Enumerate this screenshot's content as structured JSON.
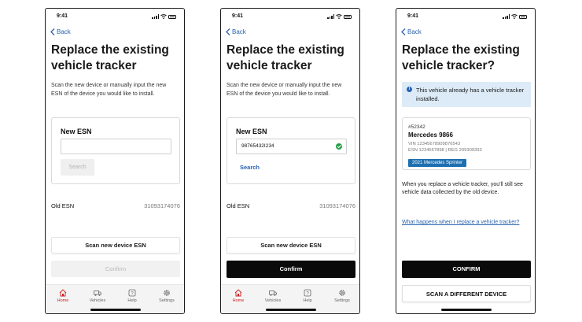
{
  "status_time": "9:41",
  "back_label": "Back",
  "screen1": {
    "title": "Replace the existing vehicle tracker",
    "description": "Scan the new device or manually input the new ESN of the device you would like to install.",
    "new_esn_label": "New ESN",
    "new_esn_value": "",
    "search_label": "Search",
    "old_esn_label": "Old ESN",
    "old_esn_value": "31093174076",
    "scan_button": "Scan new device ESN",
    "confirm_button": "Confirm"
  },
  "screen2": {
    "title": "Replace the existing vehicle tracker",
    "description": "Scan the new device or manually input the new ESN of the device you would like to install.",
    "new_esn_label": "New ESN",
    "new_esn_value": "98765432I234",
    "search_label": "Search",
    "old_esn_label": "Old ESN",
    "old_esn_value": "31093174076",
    "scan_button": "Scan new device ESN",
    "confirm_button": "Confirm"
  },
  "screen3": {
    "title": "Replace the existing vehicle tracker?",
    "info_text": "This vehicle already has a vehicle tracker installed.",
    "vehicle": {
      "number": "#52342",
      "name": "Mercedes 9866",
      "vin": "VIN 12345678909876543",
      "esn_reg": "ESN 1234567898  |  REG 209309393",
      "chip": "2021 Mercedes Sprinter"
    },
    "body_text": "When you replace a vehicle tracker, you'll still see vehicle data collected by the old device.",
    "link_text": "What happens when I replace a vehicle tracker?",
    "confirm_button": "CONFIRM",
    "scan_button": "SCAN A DIFFERENT DEVICE"
  },
  "tabs": [
    {
      "label": "Home",
      "icon": "home-icon",
      "active": true
    },
    {
      "label": "Vehicles",
      "icon": "truck-icon",
      "active": false
    },
    {
      "label": "Help",
      "icon": "help-icon",
      "active": false
    },
    {
      "label": "Settings",
      "icon": "gear-icon",
      "active": false
    }
  ],
  "colors": {
    "accent": "#2a62b0",
    "active_tab": "#c82020",
    "success": "#24a148",
    "info_bg": "#dcebf7",
    "chip": "#1d6fb0"
  }
}
